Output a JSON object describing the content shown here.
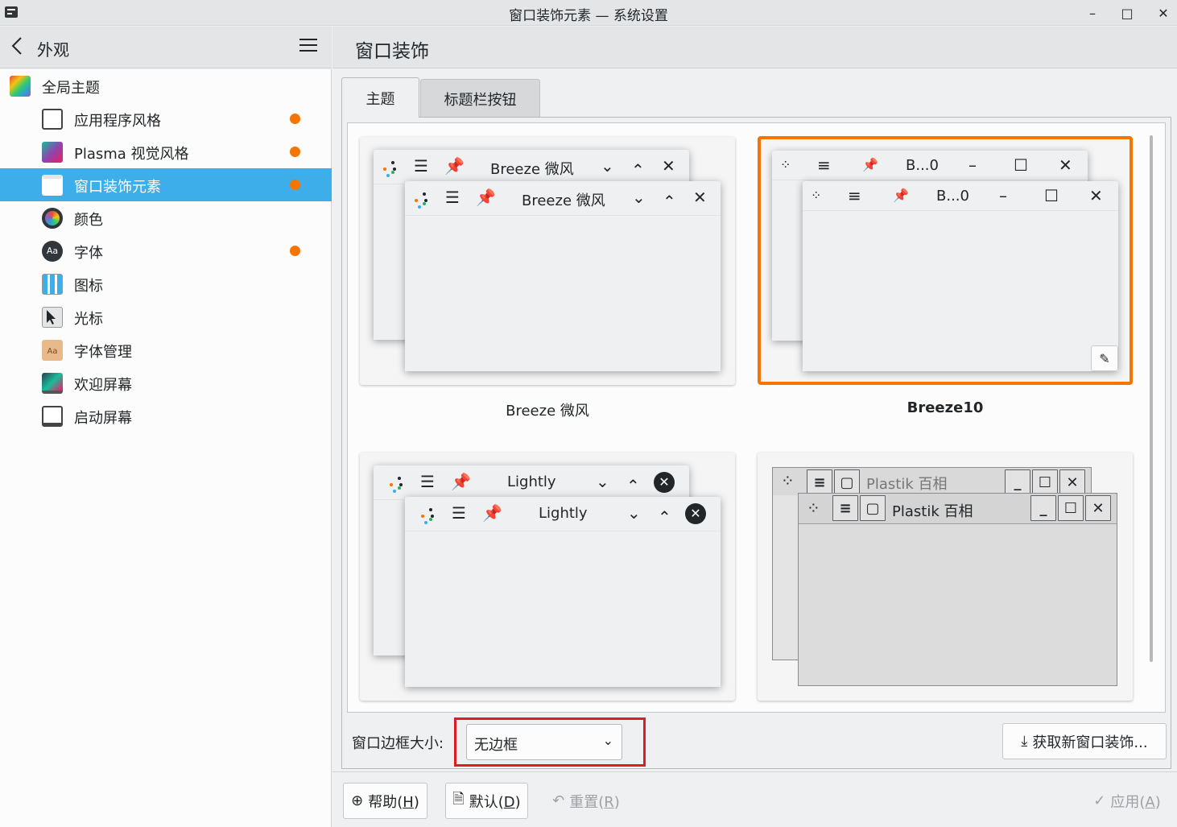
{
  "window": {
    "title": "窗口装饰元素 — 系统设置",
    "minimize": "–",
    "maximize": "□",
    "close": "✕"
  },
  "nav": {
    "back_label": "外观"
  },
  "sidebar": {
    "items": [
      {
        "label": "全局主题",
        "icon": "global-theme-icon",
        "modified": false
      },
      {
        "label": "应用程序风格",
        "icon": "application-style-icon",
        "modified": true
      },
      {
        "label": "Plasma 视觉风格",
        "icon": "plasma-style-icon",
        "modified": true
      },
      {
        "label": "窗口装饰元素",
        "icon": "window-decoration-icon",
        "modified": true,
        "selected": true
      },
      {
        "label": "颜色",
        "icon": "colors-icon",
        "modified": false
      },
      {
        "label": "字体",
        "icon": "fonts-icon",
        "modified": true
      },
      {
        "label": "图标",
        "icon": "icons-icon",
        "modified": false
      },
      {
        "label": "光标",
        "icon": "cursors-icon",
        "modified": false
      },
      {
        "label": "字体管理",
        "icon": "font-management-icon",
        "modified": false
      },
      {
        "label": "欢迎屏幕",
        "icon": "splash-screen-icon",
        "modified": false
      },
      {
        "label": "启动屏幕",
        "icon": "login-screen-icon",
        "modified": false
      }
    ]
  },
  "page": {
    "title": "窗口装饰"
  },
  "tabs": {
    "theme": "主题",
    "titlebar_buttons": "标题栏按钮"
  },
  "themes": [
    {
      "name": "Breeze 微风",
      "preview_title": "Breeze 微风",
      "selected": false
    },
    {
      "name": "Breeze10",
      "preview_title": "B...0",
      "selected": true
    },
    {
      "name": "",
      "preview_title": "Lightly",
      "selected": false
    },
    {
      "name": "",
      "preview_title": "Plastik 百相",
      "selected": false
    }
  ],
  "border_size": {
    "label": "窗口边框大小:",
    "value": "无边框"
  },
  "get_new": {
    "label": "获取新窗口装饰..."
  },
  "footer": {
    "help": "帮助(",
    "help_key": "H",
    "defaults": "默认(",
    "defaults_key": "D",
    "reset": "重置(",
    "reset_key": "R",
    "apply": "应用(",
    "apply_key": "A",
    "close_paren": ")"
  },
  "colors": {
    "accent": "#3daee9",
    "selection_border": "#f67400",
    "modified_dot": "#f67400",
    "highlight_box": "#e01b24"
  }
}
